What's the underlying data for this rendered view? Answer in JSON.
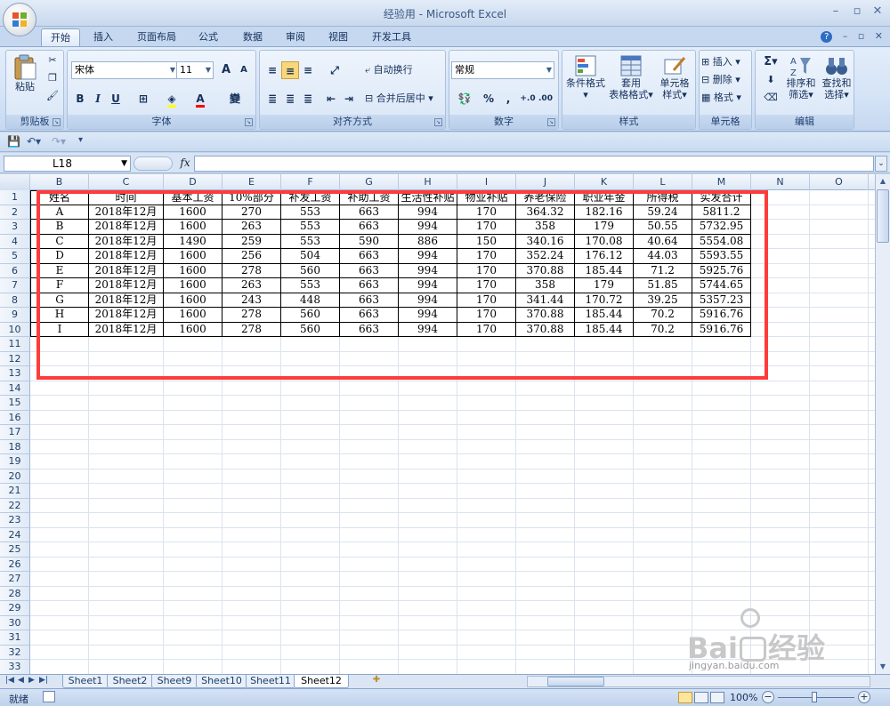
{
  "window": {
    "title": "经验用 - Microsoft Excel"
  },
  "tabs": [
    "开始",
    "插入",
    "页面布局",
    "公式",
    "数据",
    "审阅",
    "视图",
    "开发工具"
  ],
  "ribbon": {
    "clipboard": {
      "paste": "粘贴",
      "label": "剪贴板"
    },
    "font": {
      "name": "宋体",
      "size": "11",
      "label": "字体",
      "grow": "A",
      "shrink": "A",
      "bold": "B",
      "italic": "I",
      "underline": "U"
    },
    "alignment": {
      "wrap": "自动换行",
      "merge": "合并后居中",
      "label": "对齐方式"
    },
    "number": {
      "format": "常规",
      "percent": "%",
      "comma": ",",
      "label": "数字"
    },
    "styles": {
      "conditional": "条件格式",
      "table_line1": "套用",
      "table_line2": "表格格式",
      "cell_line1": "单元格",
      "cell_line2": "样式",
      "label": "样式"
    },
    "cells": {
      "insert": "插入",
      "delete": "删除",
      "format": "格式",
      "label": "单元格"
    },
    "editing": {
      "sigma": "Σ",
      "sort_line1": "排序和",
      "sort_line2": "筛选",
      "find_line1": "查找和",
      "find_line2": "选择",
      "label": "编辑"
    }
  },
  "formula_bar": {
    "name_box": "L18",
    "fx": "fx",
    "value": ""
  },
  "columns": [
    "B",
    "C",
    "D",
    "E",
    "F",
    "G",
    "H",
    "I",
    "J",
    "K",
    "L",
    "M",
    "N",
    "O"
  ],
  "rows": [
    "1",
    "2",
    "3",
    "4",
    "5",
    "6",
    "7",
    "8",
    "9",
    "10",
    "11",
    "12",
    "13",
    "14",
    "15",
    "16",
    "17",
    "18",
    "19",
    "20",
    "21",
    "22",
    "23",
    "24",
    "25",
    "26",
    "27",
    "28",
    "29",
    "30",
    "31",
    "32",
    "33"
  ],
  "table": {
    "headers": [
      "姓名",
      "时间",
      "基本工资",
      "10%部分",
      "补发工资",
      "补助工资",
      "生活性补贴",
      "物业补贴",
      "养老保险",
      "职业年金",
      "所得税",
      "实发合计"
    ],
    "rows": [
      [
        "A",
        "2018年12月",
        "1600",
        "270",
        "553",
        "663",
        "994",
        "170",
        "364.32",
        "182.16",
        "59.24",
        "5811.2"
      ],
      [
        "B",
        "2018年12月",
        "1600",
        "263",
        "553",
        "663",
        "994",
        "170",
        "358",
        "179",
        "50.55",
        "5732.95"
      ],
      [
        "C",
        "2018年12月",
        "1490",
        "259",
        "553",
        "590",
        "886",
        "150",
        "340.16",
        "170.08",
        "40.64",
        "5554.08"
      ],
      [
        "D",
        "2018年12月",
        "1600",
        "256",
        "504",
        "663",
        "994",
        "170",
        "352.24",
        "176.12",
        "44.03",
        "5593.55"
      ],
      [
        "E",
        "2018年12月",
        "1600",
        "278",
        "560",
        "663",
        "994",
        "170",
        "370.88",
        "185.44",
        "71.2",
        "5925.76"
      ],
      [
        "F",
        "2018年12月",
        "1600",
        "263",
        "553",
        "663",
        "994",
        "170",
        "358",
        "179",
        "51.85",
        "5744.65"
      ],
      [
        "G",
        "2018年12月",
        "1600",
        "243",
        "448",
        "663",
        "994",
        "170",
        "341.44",
        "170.72",
        "39.25",
        "5357.23"
      ],
      [
        "H",
        "2018年12月",
        "1600",
        "278",
        "560",
        "663",
        "994",
        "170",
        "370.88",
        "185.44",
        "70.2",
        "5916.76"
      ],
      [
        "I",
        "2018年12月",
        "1600",
        "278",
        "560",
        "663",
        "994",
        "170",
        "370.88",
        "185.44",
        "70.2",
        "5916.76"
      ]
    ]
  },
  "sheet_tabs": [
    "Sheet1",
    "Sheet2",
    "Sheet9",
    "Sheet10",
    "Sheet11",
    "Sheet12"
  ],
  "status": {
    "mode": "就绪",
    "zoom": "100%",
    "minus": "−",
    "plus": "+"
  },
  "watermark": {
    "brand": "Bai",
    "brand2": "经验",
    "url": "jingyan.baidu.com"
  },
  "colors": {
    "highlight_box": "#ff3b3b",
    "grid": "#dbe3ee",
    "ribbon": "#d4e3f6"
  }
}
